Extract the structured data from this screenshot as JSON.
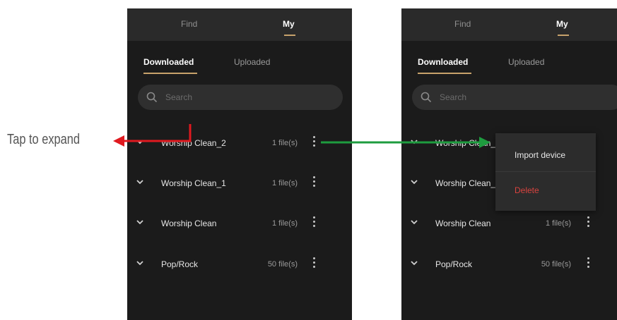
{
  "caption": "Tap to expand",
  "tabs": {
    "find": "Find",
    "my": "My"
  },
  "subtabs": {
    "downloaded": "Downloaded",
    "uploaded": "Uploaded"
  },
  "search": {
    "placeholder": "Search"
  },
  "folders": [
    {
      "name": "Worship Clean_2",
      "count": "1 file(s)"
    },
    {
      "name": "Worship Clean_1",
      "count": "1 file(s)"
    },
    {
      "name": "Worship Clean",
      "count": "1 file(s)"
    },
    {
      "name": "Pop/Rock",
      "count": "50 file(s)"
    }
  ],
  "folders_truncated": [
    {
      "name": "Worship Clean_",
      "count": ""
    },
    {
      "name": "Worship Clean_",
      "count": ""
    },
    {
      "name": "Worship Clean",
      "count": "1 file(s)"
    },
    {
      "name": "Pop/Rock",
      "count": "50 file(s)"
    }
  ],
  "context_menu": {
    "import": "Import device",
    "delete": "Delete"
  },
  "colors": {
    "accent": "#c7a26b",
    "delete": "#d9433f",
    "red_arrow": "#e0191f",
    "green_arrow": "#1e9c3f"
  }
}
